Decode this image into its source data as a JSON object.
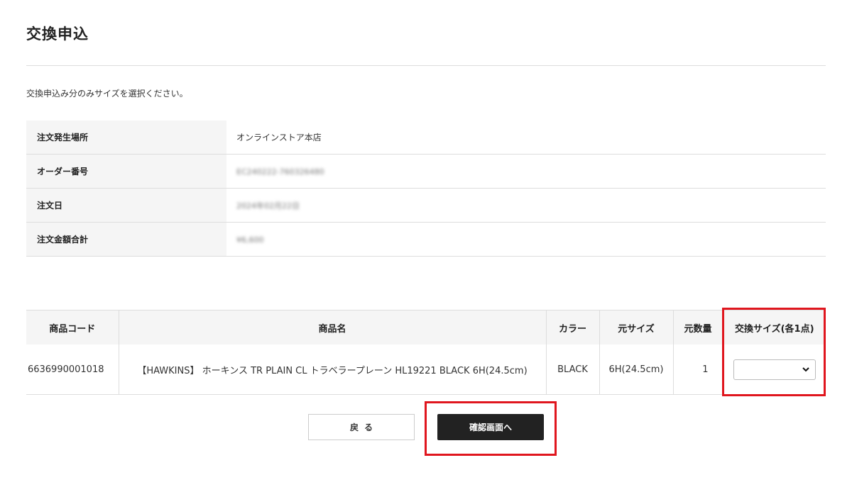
{
  "page": {
    "title": "交換申込",
    "instruction": "交換申込み分のみサイズを選択ください。"
  },
  "order_info": [
    {
      "label": "注文発生場所",
      "value": "オンラインストア本店"
    },
    {
      "label": "オーダー番号",
      "value": "EC240222-760326480"
    },
    {
      "label": "注文日",
      "value": "2024年02月22日"
    },
    {
      "label": "注文金額合計",
      "value": "¥6,600"
    }
  ],
  "product_table": {
    "headers": {
      "code": "商品コード",
      "name": "商品名",
      "color": "カラー",
      "orig_size": "元サイズ",
      "orig_qty": "元数量",
      "exchange_size": "交換サイズ(各1点)"
    },
    "rows": [
      {
        "code": "6636990001018",
        "name": "【HAWKINS】 ホーキンス TR PLAIN CL トラベラープレーン HL19221 BLACK 6H(24.5cm)",
        "color": "BLACK",
        "orig_size": "6H(24.5cm)",
        "orig_qty": "1",
        "exchange_size_selected": ""
      }
    ]
  },
  "buttons": {
    "back": "戻る",
    "confirm": "確認画面へ"
  },
  "colors": {
    "highlight": "#e0161e",
    "confirm_bg": "#222222",
    "label_bg": "#f5f5f5"
  },
  "icons": {
    "select_arrow": "chevron-down-icon"
  }
}
